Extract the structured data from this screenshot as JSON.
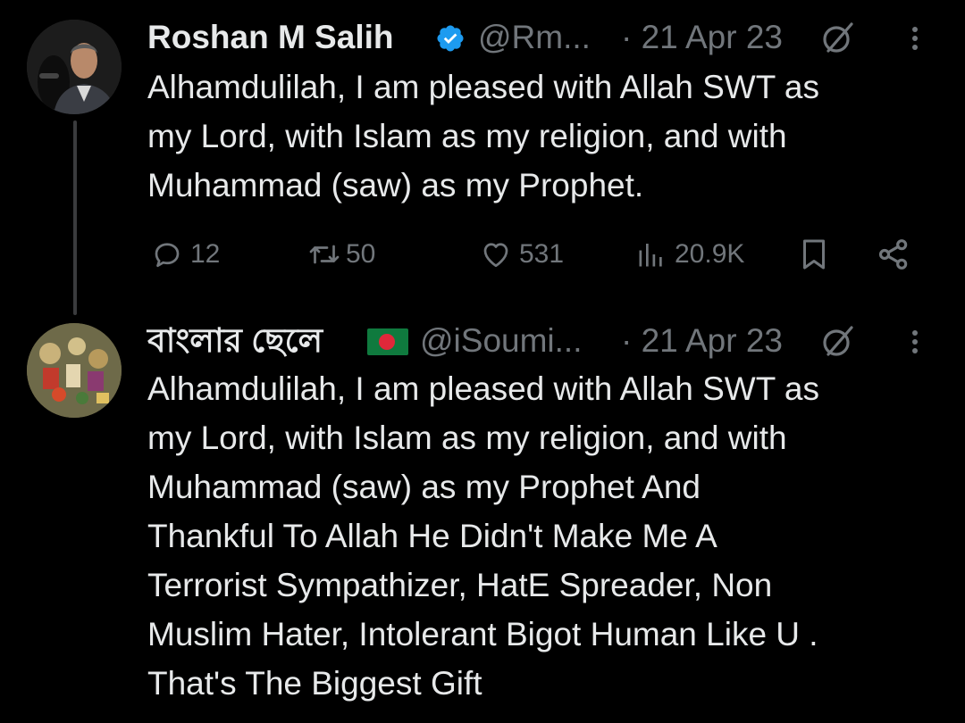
{
  "tweets": [
    {
      "display_name": "Roshan M Salih",
      "verified": true,
      "handle": "@Rm...",
      "date": "· 21 Apr 23",
      "text": "Alhamdulilah, I am pleased with Allah SWT as\nmy Lord, with Islam as my religion, and with\nMuhammad (saw) as my Prophet.",
      "actions": {
        "replies": "12",
        "reposts": "50",
        "likes": "531",
        "views": "20.9K"
      }
    },
    {
      "display_name": "বাংলার ছেলে",
      "flag_icon": "bangladesh-flag-icon",
      "handle": "@iSoumi...",
      "date": "· 21 Apr 23",
      "text": "Alhamdulilah, I am pleased with Allah SWT as\nmy Lord, with Islam as my religion, and with\nMuhammad (saw) as my Prophet And\nThankful To Allah He Didn't Make Me A\nTerrorist Sympathizer, HatE Spreader, Non\nMuslim Hater, Intolerant Bigot Human Like U .\nThat's The Biggest Gift"
    }
  ],
  "colors": {
    "background": "#000000",
    "primary_text": "#e7e9ea",
    "secondary_text": "#71767b",
    "verified_badge": "#1d9bf0",
    "thread_line": "#3a3b3d"
  }
}
